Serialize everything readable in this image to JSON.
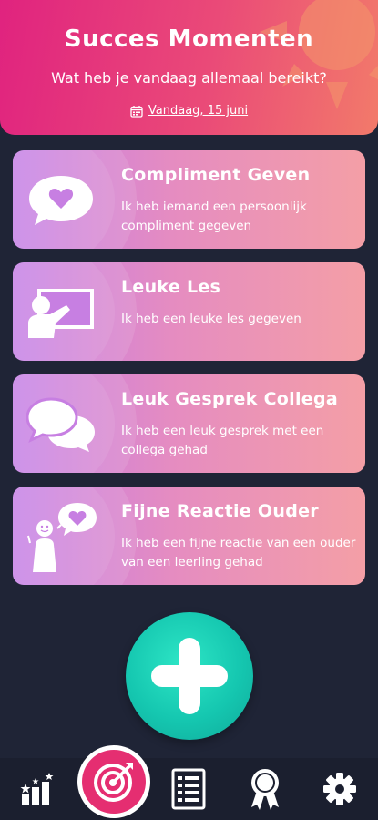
{
  "header": {
    "title": "Succes Momenten",
    "subtitle": "Wat heb je vandaag allemaal bereikt?",
    "date": "Vandaag, 15 juni",
    "date_icon": "calendar-icon"
  },
  "cards": [
    {
      "title": "Compliment Geven",
      "description": "Ik heb iemand een persoonlijk compliment gegeven",
      "icon": "heart-speech-bubble-icon"
    },
    {
      "title": "Leuke Les",
      "description": "Ik heb een leuke les gegeven",
      "icon": "teacher-board-icon"
    },
    {
      "title": "Leuk Gesprek Collega",
      "description": "Ik heb een leuk gesprek met een collega gehad",
      "icon": "conversation-bubbles-icon"
    },
    {
      "title": "Fijne Reactie Ouder",
      "description": "Ik heb een fijne reactie van een ouder van een leerling gehad",
      "icon": "person-heart-icon"
    }
  ],
  "fab": {
    "icon": "plus-icon"
  },
  "nav": [
    {
      "icon": "stats-icon"
    },
    {
      "icon": "target-icon",
      "active": true
    },
    {
      "icon": "list-icon"
    },
    {
      "icon": "award-icon"
    },
    {
      "icon": "gear-icon"
    }
  ],
  "colors": {
    "background": "#1f2436",
    "header_start": "#e0237f",
    "header_end": "#f27a6a",
    "card_start": "#c47de6",
    "card_end": "#f49fa6",
    "fab": "#15c7b0",
    "target_active": "#e52e71"
  }
}
